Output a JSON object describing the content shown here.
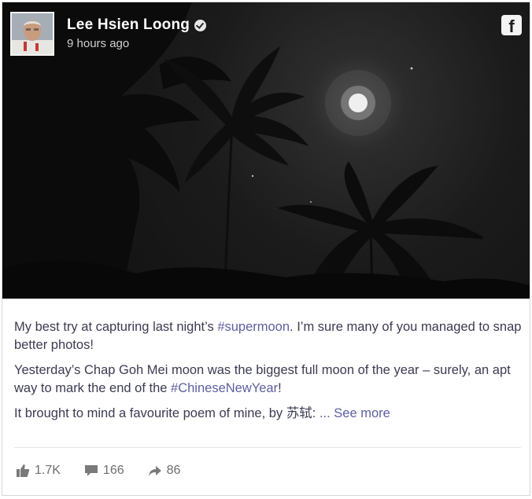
{
  "post": {
    "author": "Lee Hsien Loong",
    "timestamp": "9 hours ago",
    "platform_icon": "f",
    "paragraph1": {
      "text_a": "My best try at capturing last night’s ",
      "hashtag": "#supermoon",
      "text_b": ". I’m sure many of you managed to snap better photos!"
    },
    "paragraph2": {
      "text_a": "Yesterday’s Chap Goh Mei moon was the biggest full moon of the year – surely, an apt way to mark the end of the ",
      "hashtag": "#ChineseNewYear",
      "text_b": "!"
    },
    "paragraph3": {
      "text_a": "It brought to mind a favourite poem of mine, by 苏轼: ",
      "see_more": "... See more"
    }
  },
  "stats": {
    "likes": "1.7K",
    "comments": "166",
    "shares": "86"
  },
  "colors": {
    "text": "#3b3b52",
    "link": "#5d5fa0",
    "photo_bg": "#1b1b1b",
    "meta": "#6e6e6e"
  }
}
